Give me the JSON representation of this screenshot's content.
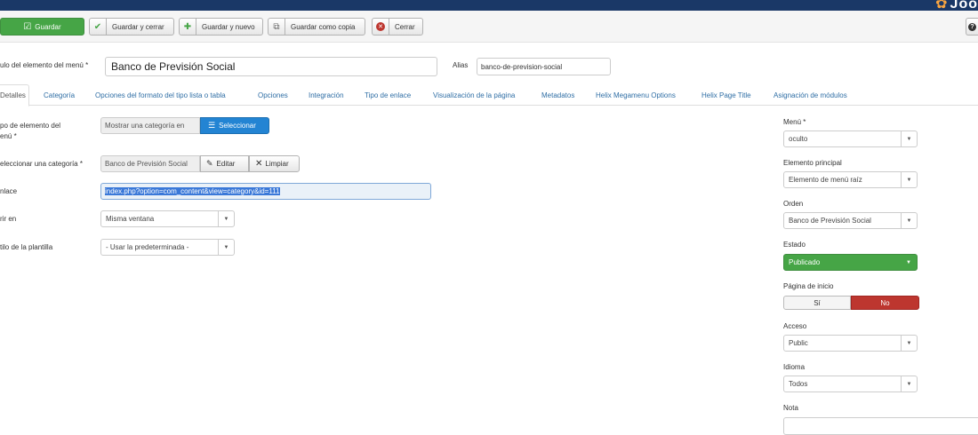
{
  "header": {
    "logo_text": "Joo"
  },
  "toolbar": {
    "save": "Guardar",
    "save_close": "Guardar y cerrar",
    "save_new": "Guardar y nuevo",
    "save_copy": "Guardar como copia",
    "close": "Cerrar",
    "help": "?"
  },
  "form": {
    "title_label": "ulo del elemento del menú *",
    "title_value": "Banco de Previsión Social",
    "alias_label": "Alias",
    "alias_value": "banco-de-prevision-social"
  },
  "tabs": [
    "Detalles",
    "Categoría",
    "Opciones del formato del tipo lista o tabla",
    "Opciones",
    "Integración",
    "Tipo de enlace",
    "Visualización de la página",
    "Metadatos",
    "Helix Megamenu Options",
    "Helix Page Title",
    "Asignación de módulos"
  ],
  "details": {
    "type_label_1": "po de elemento del",
    "type_label_2": "enú *",
    "type_value": "Mostrar una categoría en",
    "select_button": "Seleccionar",
    "category_label": "eleccionar una categoría *",
    "category_value": "Banco de Previsión Social",
    "edit_button": "Editar",
    "clear_button": "Limpiar",
    "link_label": "nlace",
    "link_value": "index.php?option=com_content&view=category&id=111",
    "open_label": "rir en",
    "open_value": "Misma ventana",
    "style_label": "tilo de la plantilla",
    "style_value": "- Usar la predeterminada -"
  },
  "sidebar": {
    "menu_label": "Menú *",
    "menu_value": "oculto",
    "parent_label": "Elemento principal",
    "parent_value": "Elemento de menú raíz",
    "order_label": "Orden",
    "order_value": "Banco de Previsión Social",
    "state_label": "Estado",
    "state_value": "Publicado",
    "home_label": "Página de inicio",
    "home_yes": "Sí",
    "home_no": "No",
    "access_label": "Acceso",
    "access_value": "Public",
    "language_label": "Idioma",
    "language_value": "Todos",
    "note_label": "Nota"
  },
  "colors": {
    "topbar": "#1a3867",
    "save_green": "#46a546",
    "select_blue": "#2384d3",
    "no_red": "#bd362f",
    "link_blue": "#2f6ea5"
  }
}
